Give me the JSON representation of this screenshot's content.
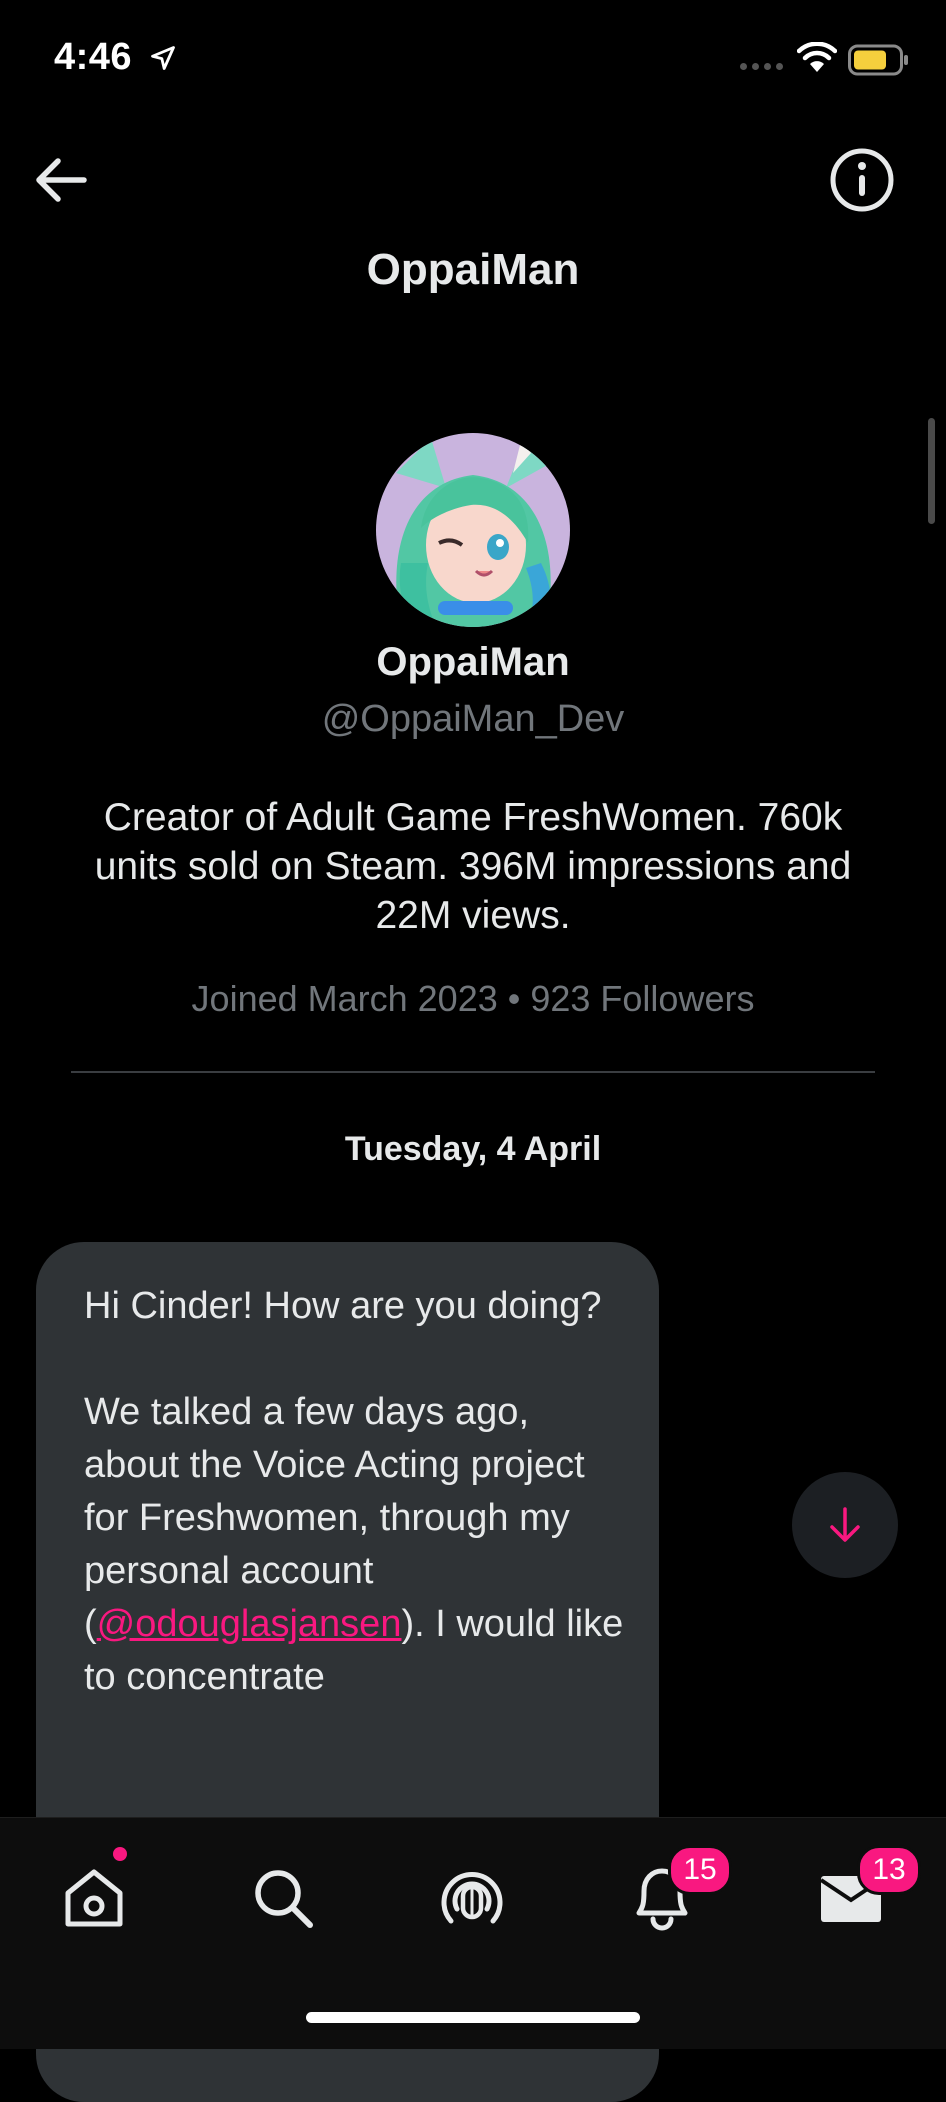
{
  "status_bar": {
    "time": "4:46",
    "icons": [
      "location-arrow-icon",
      "signal-icon",
      "wifi-icon",
      "battery-icon"
    ]
  },
  "header": {
    "title": "OppaiMan",
    "left_icon": "back-arrow-icon",
    "right_icon": "info-icon"
  },
  "profile": {
    "name": "OppaiMan",
    "handle": "@OppaiMan_Dev",
    "bio": "Creator of Adult Game FreshWomen. 760k units sold on Steam. 396M impressions and 22M views.",
    "meta": "Joined March 2023 • 923 Followers"
  },
  "conversation": {
    "date": "Tuesday, 4 April",
    "message": {
      "para1": "Hi Cinder! How are you doing?",
      "para2_before": "We talked a few days ago, about the Voice Acting project for Freshwomen, through my personal account (",
      "mention": "@odouglasjansen",
      "para2_after": "). I would like to concentrate"
    }
  },
  "tab_bar": {
    "items": [
      {
        "name": "home",
        "icon": "home-icon"
      },
      {
        "name": "search",
        "icon": "search-icon"
      },
      {
        "name": "spaces",
        "icon": "spaces-icon"
      },
      {
        "name": "notifications",
        "icon": "bell-icon",
        "badge": "15"
      },
      {
        "name": "messages",
        "icon": "mail-icon",
        "badge": "13"
      }
    ]
  },
  "colors": {
    "background": "#000000",
    "accent": "#f91880",
    "bubble": "#2f3336",
    "muted_text": "#71767b"
  }
}
